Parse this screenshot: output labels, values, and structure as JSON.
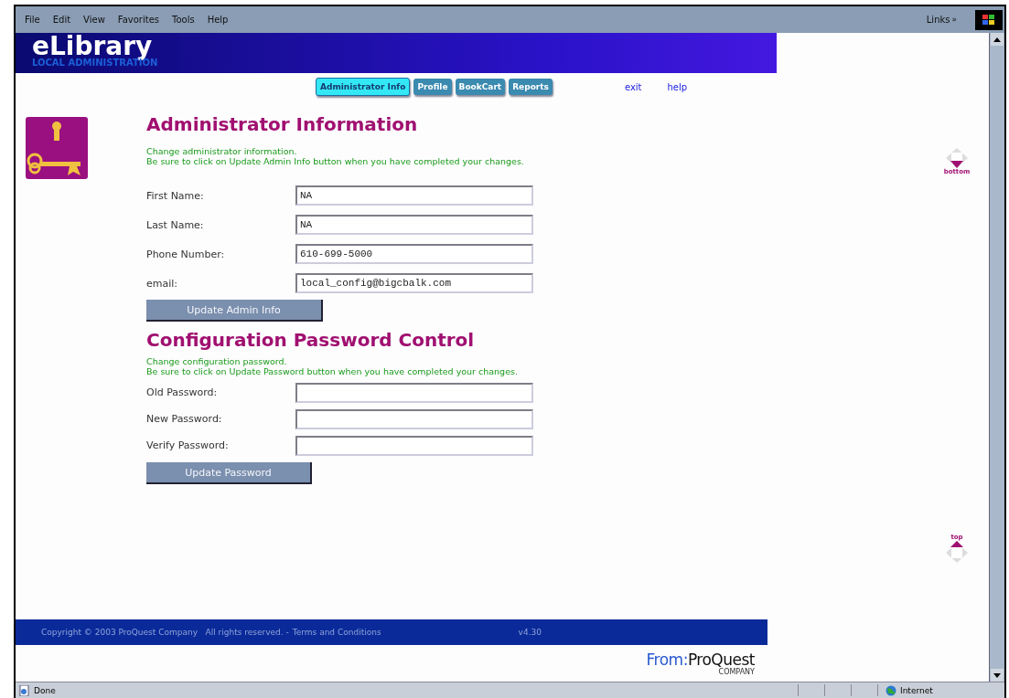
{
  "menu_bar": {
    "items": [
      "File",
      "Edit",
      "View",
      "Favorites",
      "Tools",
      "Help"
    ],
    "links_label": "Links",
    "links_chevron": "»"
  },
  "banner": {
    "title": "eLibrary",
    "subtitle": "LOCAL ADMINISTRATION"
  },
  "tabs": [
    {
      "label": "Administrator Info",
      "selected": true
    },
    {
      "label": "Profile",
      "selected": false
    },
    {
      "label": "BookCart",
      "selected": false
    },
    {
      "label": "Reports",
      "selected": false
    }
  ],
  "top_links": [
    "exit",
    "help"
  ],
  "admin_info": {
    "heading": "Administrator Information",
    "instructions": [
      "Change administrator information.",
      "Be sure to click on Update Admin Info button when you have completed your changes."
    ],
    "fields": [
      {
        "label": "First Name:",
        "value": "NA"
      },
      {
        "label": "Last Name:",
        "value": "NA"
      },
      {
        "label": "Phone Number:",
        "value": "610-699-5000"
      },
      {
        "label": "email:",
        "value": "local_config@bigcbalk.com"
      }
    ],
    "button": "Update Admin Info"
  },
  "password_control": {
    "heading": "Configuration Password Control",
    "instructions": [
      "Change configuration password.",
      "Be sure to click on Update Password button when you have completed your changes."
    ],
    "fields": [
      {
        "label": "Old Password:"
      },
      {
        "label": "New Password:"
      },
      {
        "label": "Verify Password:"
      }
    ],
    "button": "Update Password"
  },
  "page_nav": {
    "bottom_label": "bottom",
    "top_label": "top"
  },
  "footer": {
    "copyright": "Copyright © 2003 ProQuest Company   All rights reserved. -",
    "terms_link": "Terms and Conditions",
    "version": "v4.30"
  },
  "logo": {
    "prefix": "From:",
    "name": "ProQuest",
    "tagline": "COMPANY"
  },
  "status_bar": {
    "status": "Done",
    "zone": "Internet"
  }
}
